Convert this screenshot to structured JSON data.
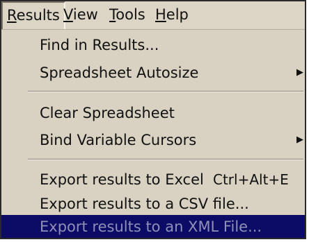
{
  "menubar": {
    "results": {
      "mnemonic": "R",
      "rest": "esults"
    },
    "view": {
      "mnemonic": "V",
      "rest": "iew"
    },
    "tools": {
      "mnemonic": "T",
      "rest": "ools"
    },
    "help": {
      "mnemonic": "H",
      "rest": "elp"
    }
  },
  "menu": {
    "find": "Find in Results...",
    "autosize": "Spreadsheet Autosize",
    "clear": "Clear Spreadsheet",
    "bind": "Bind Variable Cursors",
    "excel": "Export results to Excel",
    "excel_shortcut": "Ctrl+Alt+E",
    "csv": "Export results to a CSV file...",
    "xml": "Export results to an XML File...",
    "submenu_arrow_icon": "triangle-right"
  },
  "colors": {
    "menu_background": "#d9d2c2",
    "highlight_background": "#0c0c66",
    "highlight_text": "#8f8fb8"
  }
}
